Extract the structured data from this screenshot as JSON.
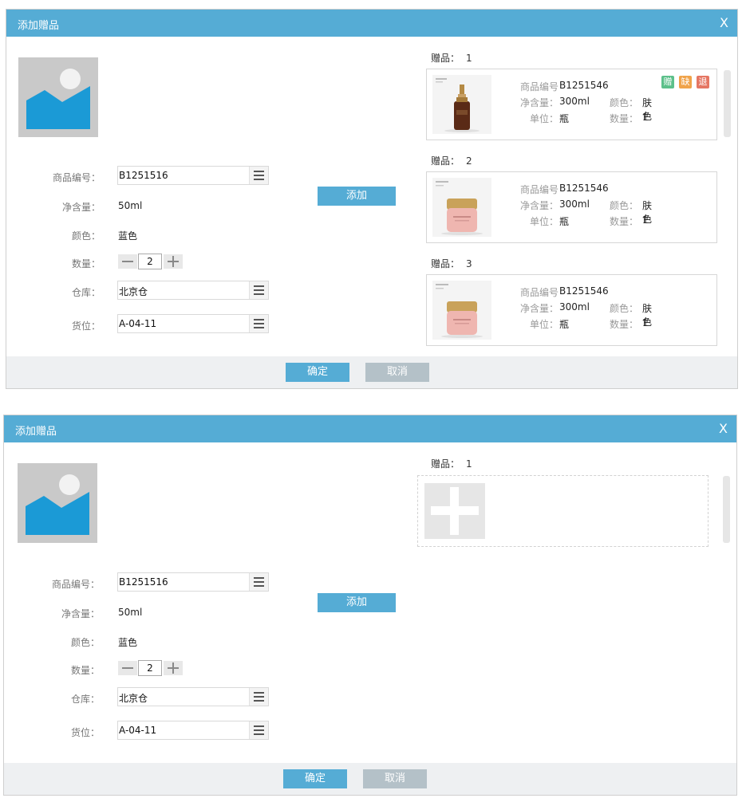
{
  "dialog1": {
    "title": "添加赠品",
    "close_label": "X",
    "form": {
      "product_code_label": "商品编号：",
      "product_code_value": "B1251516",
      "net_content_label": "净含量：",
      "net_content_value": "50ml",
      "color_label": "颜色：",
      "color_value": "蓝色",
      "quantity_label": "数量：",
      "quantity_value": "2",
      "warehouse_label": "仓库：",
      "warehouse_value": "北京仓",
      "location_label": "货位：",
      "location_value": "A-04-11"
    },
    "add_button": "添加",
    "gifts": [
      {
        "title": "赠品：",
        "index": "1",
        "code_label": "商品编号",
        "code": "B1251546",
        "content_label": "净含量：",
        "content": "300ml",
        "color_label": "颜色：",
        "color": "肤色",
        "unit_label": "单位：",
        "unit": "瓶",
        "qty_label": "数量：",
        "qty": "1",
        "badges": [
          "赠",
          "缺",
          "退"
        ]
      },
      {
        "title": "赠品：",
        "index": "2",
        "code_label": "商品编号",
        "code": "B1251546",
        "content_label": "净含量：",
        "content": "300ml",
        "color_label": "颜色：",
        "color": "肤色",
        "unit_label": "单位：",
        "unit": "瓶",
        "qty_label": "数量：",
        "qty": "1"
      },
      {
        "title": "赠品：",
        "index": "3",
        "code_label": "商品编号",
        "code": "B1251546",
        "content_label": "净含量：",
        "content": "300ml",
        "color_label": "颜色：",
        "color": "肤色",
        "unit_label": "单位：",
        "unit": "瓶",
        "qty_label": "数量：",
        "qty": "1"
      }
    ],
    "ok_button": "确定",
    "cancel_button": "取消"
  },
  "dialog2": {
    "title": "添加赠品",
    "close_label": "X",
    "form": {
      "product_code_label": "商品编号：",
      "product_code_value": "B1251516",
      "net_content_label": "净含量：",
      "net_content_value": "50ml",
      "color_label": "颜色：",
      "color_value": "蓝色",
      "quantity_label": "数量：",
      "quantity_value": "2",
      "warehouse_label": "仓库：",
      "warehouse_value": "北京仓",
      "location_label": "货位：",
      "location_value": "A-04-11"
    },
    "add_button": "添加",
    "gift_title": "赠品：",
    "gift_index": "1",
    "ok_button": "确定",
    "cancel_button": "取消"
  },
  "colors": {
    "header": "#55acd5",
    "primary_button": "#55acd5",
    "cancel_button": "#b4c1c8",
    "badge_gift": "#5cc08a",
    "badge_missing": "#f0a34a",
    "badge_return": "#e57663",
    "image_placeholder": "#c9c9c9",
    "image_mountain": "#1b9ad6"
  },
  "icons": {
    "close": "close-icon",
    "field_menu": "menu-icon",
    "image_placeholder": "image-placeholder-icon",
    "stepper_minus": "minus-icon",
    "stepper_plus": "plus-icon",
    "add_slot": "plus-icon"
  }
}
